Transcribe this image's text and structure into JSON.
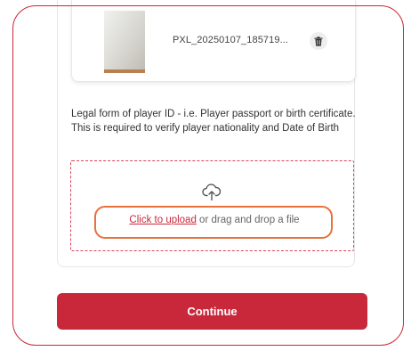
{
  "uploaded_file": {
    "name": "PXL_20250107_185719...",
    "thumbnail_icon": "file-thumbnail",
    "delete_icon": "trash-icon"
  },
  "document_field": {
    "instruction": "Legal form of player ID - i.e. Player passport or birth certificate. This is required to verify player nationality and Date of Birth",
    "dropzone": {
      "upload_icon": "cloud-upload-icon",
      "link_label": "Click to upload",
      "suffix_text": " or drag and drop a file"
    }
  },
  "actions": {
    "continue_label": "Continue"
  },
  "colors": {
    "brand": "#c8283a",
    "highlight": "#e6713c"
  }
}
